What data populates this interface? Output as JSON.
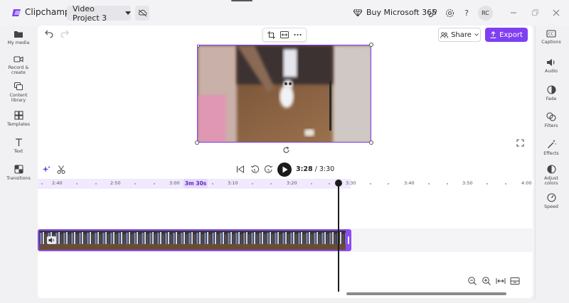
{
  "app": {
    "name": "Clipchamp",
    "project_name": "Video Project 3",
    "buy_label": "Buy Microsoft 365",
    "avatar_initials": "RC"
  },
  "left_nav": [
    {
      "label": "My media",
      "icon": "folder-icon"
    },
    {
      "label": "Record & create",
      "icon": "camera-icon"
    },
    {
      "label": "Content library",
      "icon": "library-icon"
    },
    {
      "label": "Templates",
      "icon": "templates-icon"
    },
    {
      "label": "Text",
      "icon": "text-icon"
    },
    {
      "label": "Transitions",
      "icon": "transitions-icon"
    }
  ],
  "right_nav": [
    {
      "label": "Captions",
      "icon": "captions-icon"
    },
    {
      "label": "Audio",
      "icon": "speaker-icon"
    },
    {
      "label": "Fade",
      "icon": "fade-icon"
    },
    {
      "label": "Filters",
      "icon": "filters-icon"
    },
    {
      "label": "Effects",
      "icon": "magic-wand-icon"
    },
    {
      "label": "Adjust colors",
      "icon": "contrast-icon"
    },
    {
      "label": "Speed",
      "icon": "gauge-icon"
    }
  ],
  "toolbar": {
    "share_label": "Share",
    "export_label": "Export"
  },
  "playback": {
    "current_time": "3:28",
    "separator": " / ",
    "total_time": "3:30"
  },
  "timeline": {
    "ticks": [
      "2:40",
      "2:50",
      "3:00",
      "3:10",
      "3:20",
      "3:30",
      "3:40",
      "3:50",
      "4:00"
    ],
    "selection_duration": "3m 30s"
  },
  "colors": {
    "accent": "#7f3ff2",
    "selection": "#f1e9fe"
  }
}
